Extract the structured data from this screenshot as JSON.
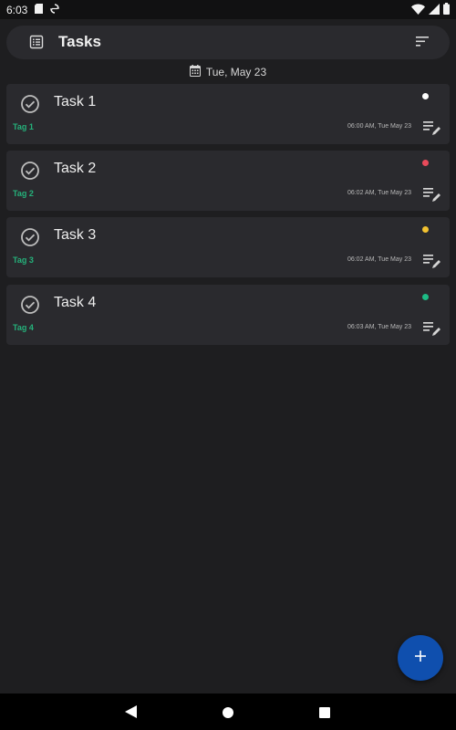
{
  "status_bar": {
    "time": "6:03",
    "left_icons": [
      "sd-card-icon",
      "sync-icon"
    ],
    "right_icons": [
      "wifi-icon",
      "signal-icon",
      "battery-icon"
    ]
  },
  "app_bar": {
    "title": "Tasks",
    "menu_icon": "list-icon",
    "sort_icon": "sort-icon"
  },
  "date_header": {
    "icon": "calendar-icon",
    "label": "Tue, May 23"
  },
  "tasks": [
    {
      "title": "Task 1",
      "tag": "Tag 1",
      "timestamp": "06:00 AM, Tue May 23",
      "priority_color": "#ffffff"
    },
    {
      "title": "Task 2",
      "tag": "Tag 2",
      "timestamp": "06:02 AM, Tue May 23",
      "priority_color": "#e84a5a"
    },
    {
      "title": "Task 3",
      "tag": "Tag 3",
      "timestamp": "06:02 AM, Tue May 23",
      "priority_color": "#f2c230"
    },
    {
      "title": "Task 4",
      "tag": "Tag 4",
      "timestamp": "06:03 AM, Tue May 23",
      "priority_color": "#1dbb85"
    }
  ],
  "fab": {
    "icon": "plus-icon",
    "label": "+"
  },
  "nav_bar": {
    "icons": [
      "back-icon",
      "home-icon",
      "recents-icon"
    ]
  },
  "colors": {
    "background": "#1e1e20",
    "card": "#2a2a2e",
    "tag": "#25b27b",
    "fab": "#0f4fae"
  }
}
